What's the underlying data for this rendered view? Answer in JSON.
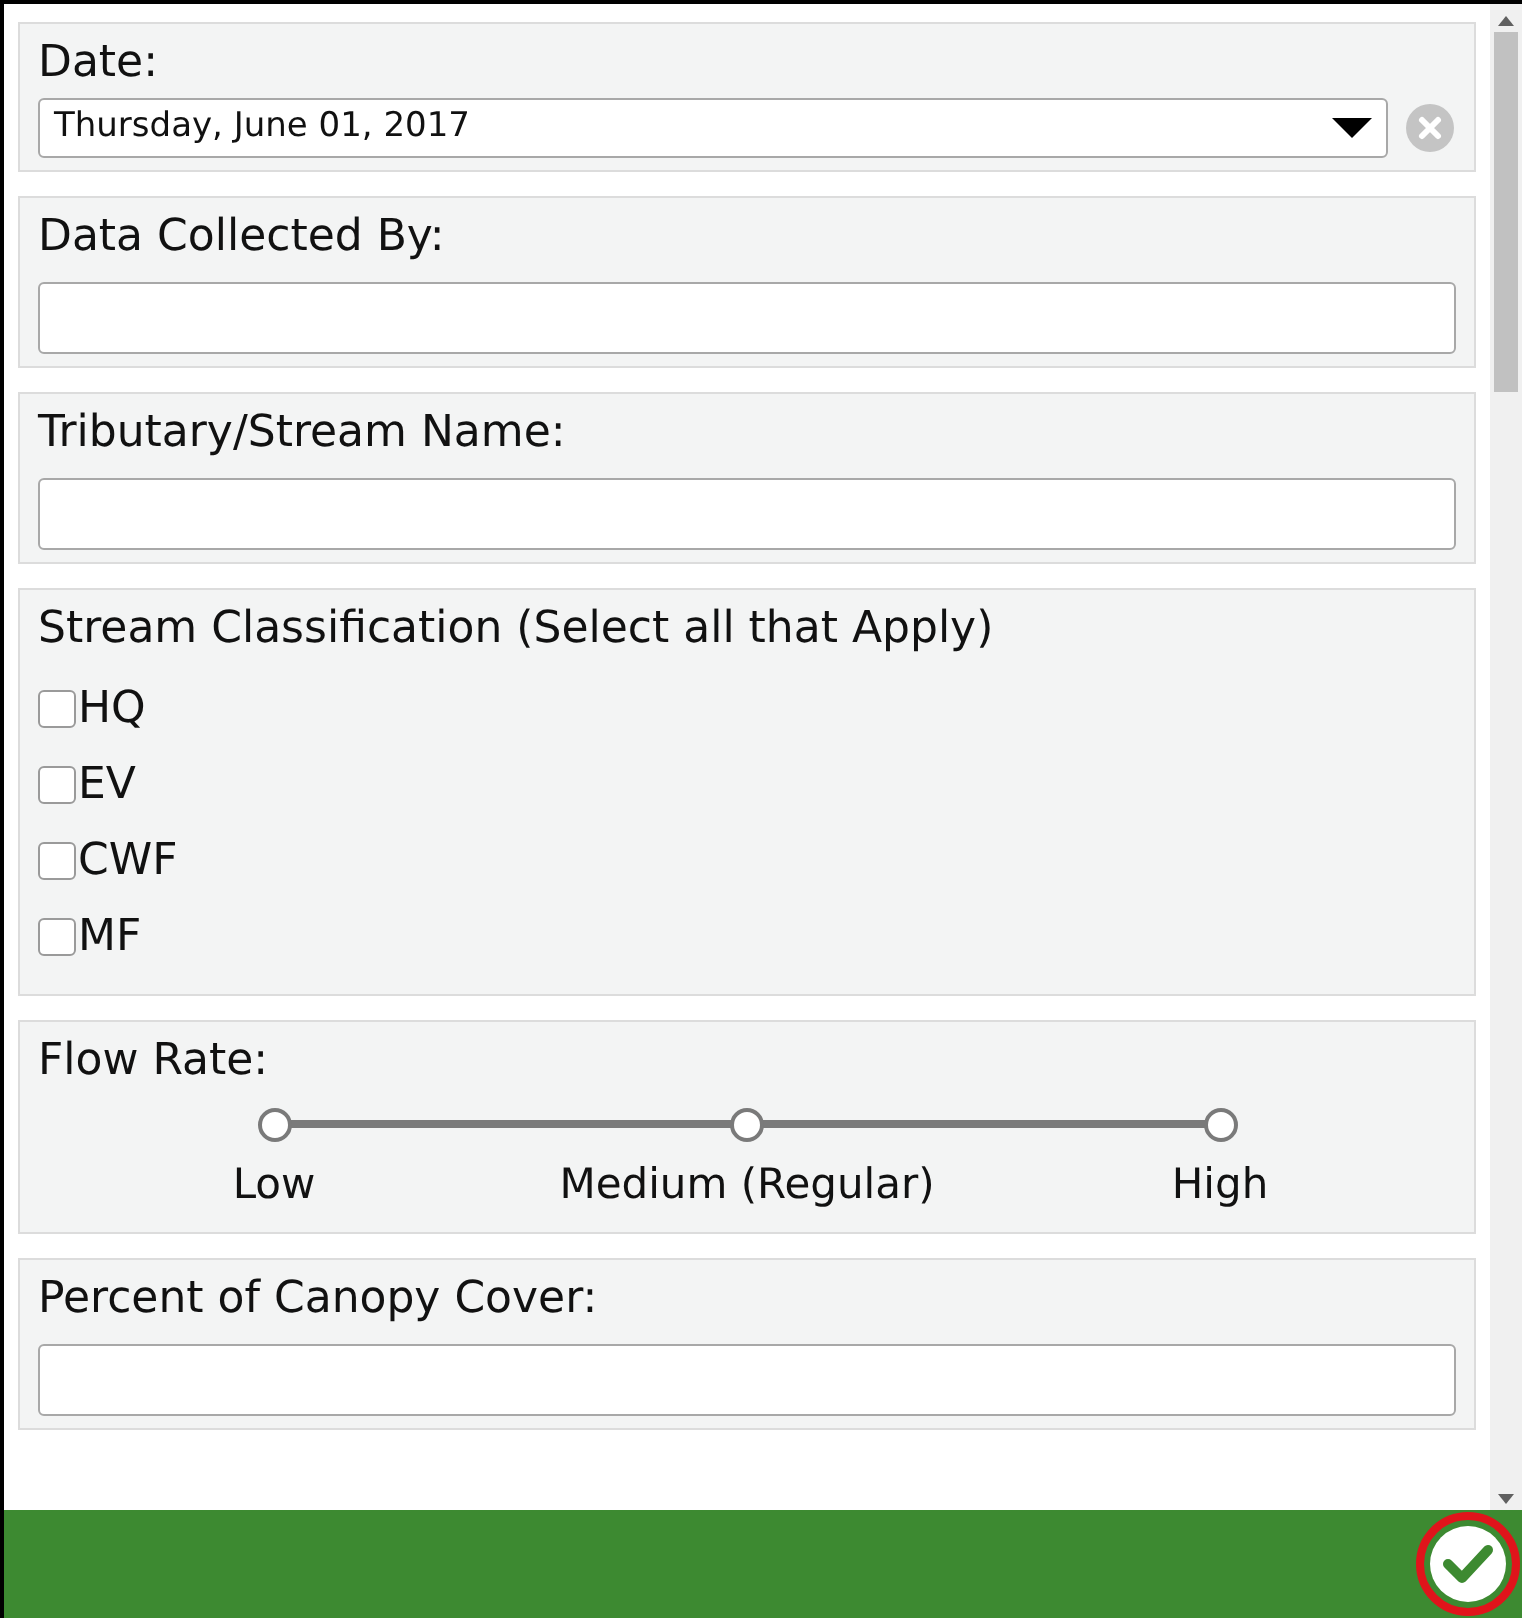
{
  "date": {
    "label": "Date:",
    "value": "Thursday, June 01, 2017"
  },
  "collected_by": {
    "label": "Data Collected By:"
  },
  "stream_name": {
    "label": "Tributary/Stream Name:"
  },
  "classification": {
    "label": "Stream Classification (Select all that Apply)",
    "options": [
      {
        "label": "HQ",
        "checked": false
      },
      {
        "label": "EV",
        "checked": false
      },
      {
        "label": "CWF",
        "checked": false
      },
      {
        "label": "MF",
        "checked": false
      }
    ]
  },
  "flow_rate": {
    "label": "Flow Rate:",
    "options": [
      {
        "label": "Low",
        "selected": false
      },
      {
        "label": "Medium (Regular)",
        "selected": false
      },
      {
        "label": "High",
        "selected": false
      }
    ]
  },
  "canopy_cover": {
    "label": "Percent of Canopy Cover:"
  }
}
